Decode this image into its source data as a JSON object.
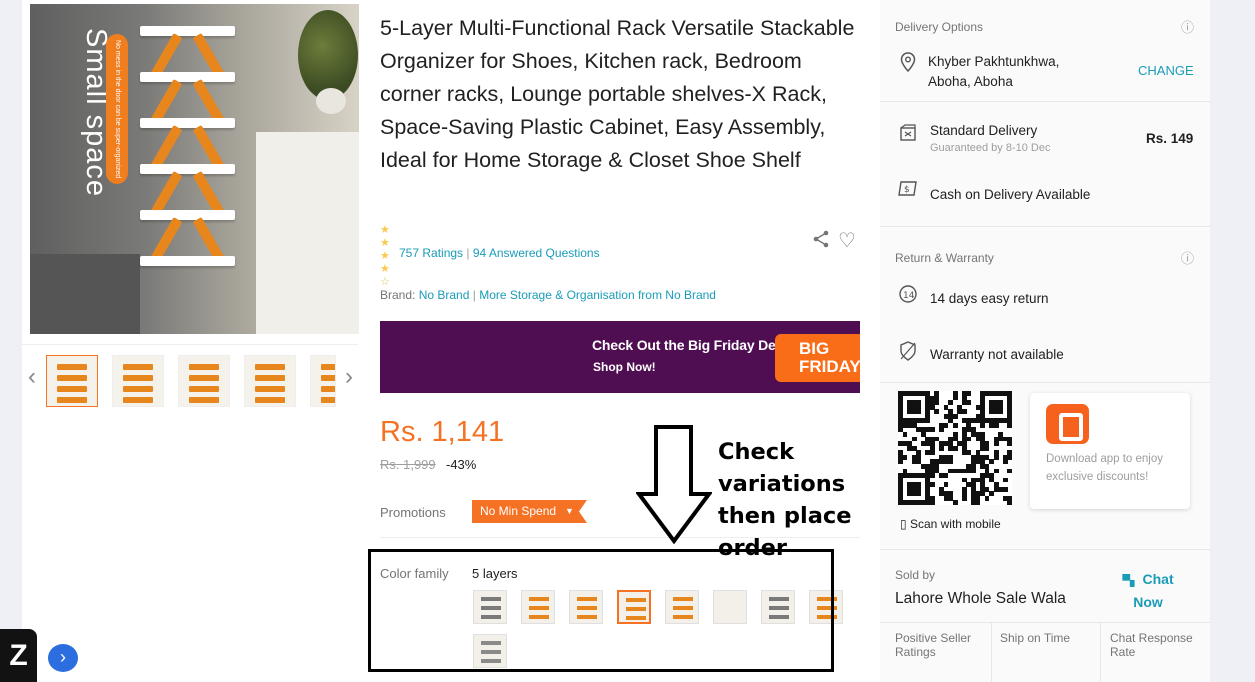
{
  "product": {
    "title": "5-Layer Multi-Functional Rack Versatile Stackable Organizer for Shoes, Kitchen rack, Bedroom corner racks, Lounge portable shelves-X Rack, Space-Saving Plastic Cabinet, Easy Assembly, Ideal for Home Storage & Closet Shoe Shelf",
    "image_caption": "Small space",
    "image_pill_text": "No mess in the door can be super-organized efficiently",
    "rating_stars": 4.5,
    "ratings_link": "757 Ratings",
    "questions_link": "94 Answered Questions",
    "brand_label": "Brand:",
    "brand_value": "No Brand",
    "more_link": "More Storage & Organisation from No Brand",
    "price": "Rs. 1,141",
    "old_price": "Rs. 1,999",
    "discount": "-43%",
    "promotions_label": "Promotions",
    "promo_tag": "No Min Spend",
    "color_family_label": "Color family",
    "color_family_value": "5 layers",
    "variation_count": 8,
    "selected_variation_index": 3
  },
  "banner": {
    "line1": "Check Out the Big Friday Deals",
    "line2": "Shop Now!",
    "badge": "BIG FRIDAY",
    "bg_color": "#4f0d52",
    "badge_color": "#f96d18"
  },
  "annotation": {
    "text": "Check variations then place order"
  },
  "delivery": {
    "heading": "Delivery Options",
    "location": "Khyber Pakhtunkhwa, Aboha, Aboha",
    "change_link": "CHANGE",
    "standard_label": "Standard Delivery",
    "standard_sub": "Guaranteed by 8-10 Dec",
    "standard_fee": "Rs. 149",
    "cod_label": "Cash on Delivery Available"
  },
  "warranty": {
    "heading": "Return & Warranty",
    "return_label": "14 days easy return",
    "warranty_label": "Warranty not available"
  },
  "app": {
    "scan_label": "Scan with mobile",
    "promo_text": "Download app to enjoy exclusive discounts!"
  },
  "seller": {
    "sold_by_label": "Sold by",
    "name": "Lahore Whole Sale Wala",
    "chat_label": "Chat Now",
    "metrics": [
      "Positive Seller Ratings",
      "Ship on Time",
      "Chat Response Rate"
    ]
  },
  "icons": {
    "info": "info-icon",
    "location": "location-pin-icon",
    "delivery": "delivery-box-icon",
    "cod": "cash-on-delivery-icon",
    "return": "return-14-days-icon",
    "warranty": "warranty-shield-icon",
    "share": "share-icon",
    "heart": "heart-icon",
    "chat": "chat-icon"
  },
  "colors": {
    "accent": "#f57224",
    "link": "#1a9cb7",
    "star": "#faca51"
  }
}
